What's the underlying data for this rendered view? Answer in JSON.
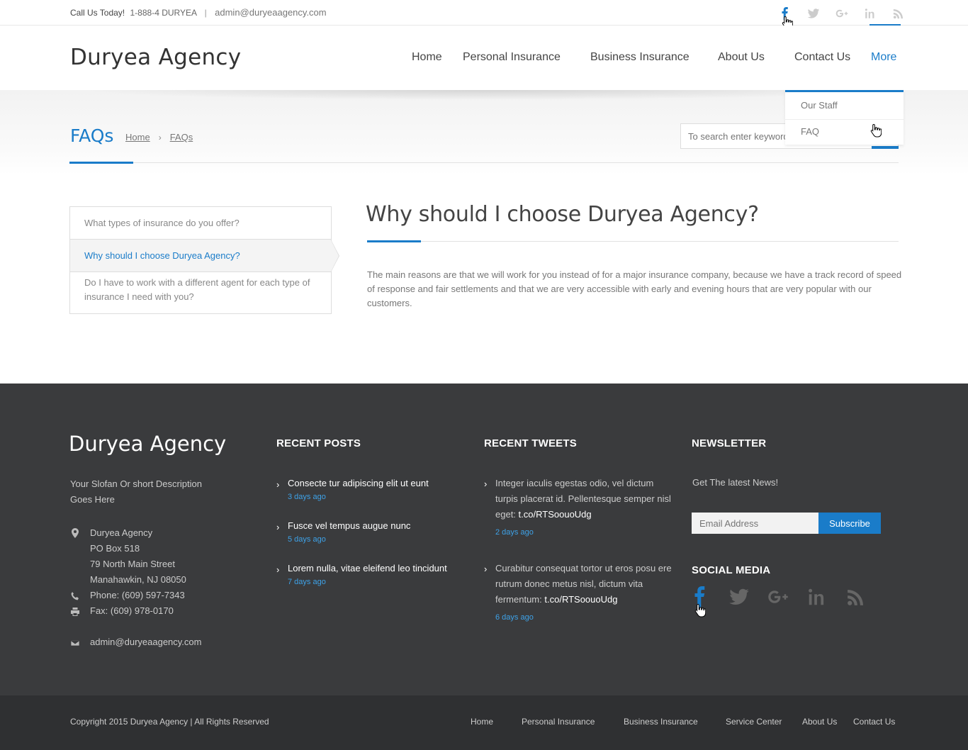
{
  "topbar": {
    "call_label": "Call Us Today!",
    "phone": "1-888-4 DURYEA",
    "separator": "|",
    "email": "admin@duryeaagency.com",
    "social_icons": [
      "facebook-icon",
      "twitter-icon",
      "google-plus-icon",
      "linkedin-icon",
      "rss-icon"
    ]
  },
  "header": {
    "logo": "Duryea Agency",
    "nav": [
      {
        "label": "Home"
      },
      {
        "label": "Personal Insurance"
      },
      {
        "label": "Business Insurance"
      },
      {
        "label": "About Us"
      },
      {
        "label": "Contact Us"
      },
      {
        "label": "More",
        "active": true
      }
    ]
  },
  "dropdown": {
    "items": [
      "Our Staff",
      "FAQ"
    ]
  },
  "page": {
    "title": "FAQs",
    "breadcrumb": [
      "Home",
      "FAQs"
    ],
    "search_placeholder": "To search enter keywords"
  },
  "faq": {
    "questions": [
      "What types of insurance do you offer?",
      "Why should I choose Duryea Agency?",
      "Do I have to work with a different agent for each type of insurance I need with you?"
    ],
    "active_index": 1,
    "answer_title": "Why should I choose Duryea Agency?",
    "answer_text": "The main reasons are that we will work for you instead of for a major insurance company, because we have a track record of speed of response and fair settlements and that we are very accessible with early and evening hours that are very popular with our customers."
  },
  "footer": {
    "logo": "Duryea Agency",
    "slogan": "Your Slofan Or short Description Goes Here",
    "address": [
      "Duryea Agency",
      "PO Box 518",
      "79 North Main Street",
      "Manahawkin, NJ 08050"
    ],
    "phone": "Phone: (609) 597-7343",
    "fax": "Fax: (609) 978-0170",
    "email": "admin@duryeaagency.com",
    "recent_posts_heading": "RECENT POSTS",
    "recent_posts": [
      {
        "title": "Consecte tur adipiscing elit ut eunt",
        "date": "3 days ago"
      },
      {
        "title": "Fusce vel tempus augue nunc",
        "date": "5 days ago"
      },
      {
        "title": "Lorem nulla, vitae eleifend leo tincidunt",
        "date": "7 days ago"
      }
    ],
    "recent_tweets_heading": "RECENT TWEETS",
    "recent_tweets": [
      {
        "text": "Integer iaculis egestas odio, vel dictum turpis placerat id. Pellentesque semper nisl eget:",
        "link": "t.co/RTSoouoUdg",
        "date": "2 days ago"
      },
      {
        "text": "Curabitur consequat tortor ut eros posu ere rutrum donec metus nisl, dictum vita fermentum:",
        "link": "t.co/RTSoouoUdg",
        "date": "6 days ago"
      }
    ],
    "newsletter_heading": "NEWSLETTER",
    "newsletter_text": "Get The latest News!",
    "email_placeholder": "Email Address",
    "subscribe_label": "Subscribe",
    "social_heading": "SOCIAL MEDIA",
    "social_icons": [
      "facebook-icon",
      "twitter-icon",
      "google-plus-icon",
      "linkedin-icon",
      "rss-icon"
    ]
  },
  "bottombar": {
    "copyright": "Copyright 2015 Duryea Agency | All Rights Reserved",
    "nav": [
      "Home",
      "Personal Insurance",
      "Business Insurance",
      "Service Center",
      "About Us",
      "Contact Us"
    ]
  },
  "colors": {
    "accent": "#1a7cc9",
    "footer_bg": "#3a3b3d",
    "bottom_bg": "#2f3032",
    "date_blue": "#3ea2e8"
  }
}
